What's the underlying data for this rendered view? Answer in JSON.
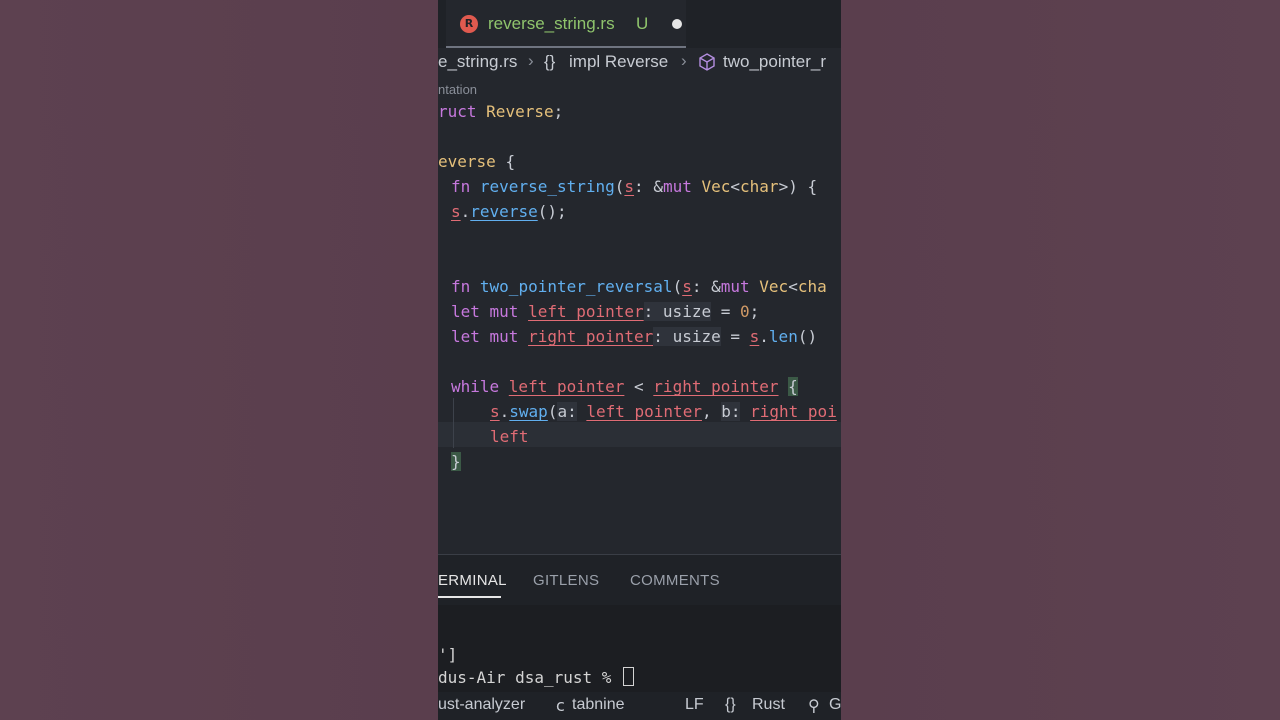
{
  "tab": {
    "icon": "rust-file-icon",
    "icon_glyph": "R",
    "filename": "reverse_string.rs",
    "status": "U"
  },
  "breadcrumb": {
    "file": "e_string.rs",
    "impl_icon": "{}",
    "impl": "impl Reverse",
    "method": "two_pointer_r"
  },
  "codelens": "ntation",
  "code": {
    "l1": [
      "ruct ",
      "Reverse",
      ";"
    ],
    "l3": [
      "everse ",
      "{"
    ],
    "l4": [
      "fn ",
      "reverse_string",
      "(",
      "s",
      ": ",
      "&",
      "mut ",
      "Vec",
      "<",
      "char",
      ">) {"
    ],
    "l5": [
      "s",
      ".",
      "reverse",
      "();"
    ],
    "l8": [
      "fn ",
      "two_pointer_reversal",
      "(",
      "s",
      ": ",
      "&",
      "mut ",
      "Vec",
      "<",
      "cha"
    ],
    "l9": [
      "let ",
      "mut ",
      "left_pointer",
      ": usize",
      " = ",
      "0",
      ";"
    ],
    "l10": [
      "let ",
      "mut ",
      "right_pointer",
      ": usize",
      " = ",
      "s",
      ".",
      "len",
      "() "
    ],
    "l12": [
      "while ",
      "left_pointer",
      " < ",
      "right_pointer",
      " ",
      "{"
    ],
    "l13": [
      "s",
      ".",
      "swap",
      "(",
      "a:",
      " ",
      "left_pointer",
      ", ",
      "b:",
      " ",
      "right_poi"
    ],
    "l14": [
      "left"
    ],
    "l15": [
      "}"
    ]
  },
  "panel": {
    "tabs": [
      "ERMINAL",
      "GITLENS",
      "COMMENTS"
    ],
    "terminal_lines": [
      "']",
      "dus-Air dsa_rust % "
    ]
  },
  "statusbar": {
    "left1": "ust-analyzer",
    "tabnine_icon": "c",
    "tabnine": "tabnine",
    "eol": "LF",
    "lang_icon": "{}",
    "lang": "Rust",
    "extra_icon": "⚲",
    "extra": "G"
  }
}
